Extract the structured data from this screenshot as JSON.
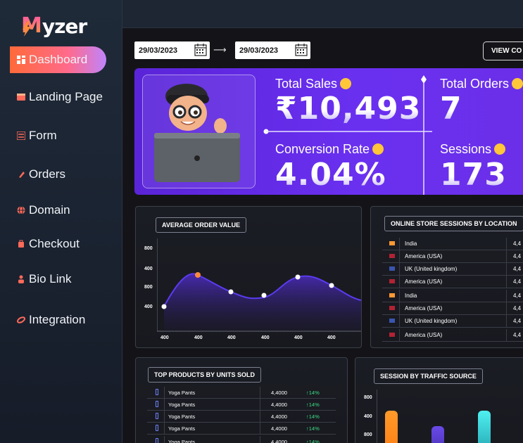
{
  "brand": {
    "logo_initial": "M",
    "logo_rest": "yzer"
  },
  "sidebar": {
    "items": [
      {
        "label": "Dashboard",
        "icon": "grid-icon",
        "active": true
      },
      {
        "label": "Landing Page",
        "icon": "landing-page-icon"
      },
      {
        "label": "Form",
        "icon": "form-icon"
      },
      {
        "label": "Orders",
        "icon": "orders-icon"
      },
      {
        "label": "Domain",
        "icon": "globe-icon"
      },
      {
        "label": "Checkout",
        "icon": "checkout-icon"
      },
      {
        "label": "Bio Link",
        "icon": "user-icon"
      },
      {
        "label": "Integration",
        "icon": "link-icon"
      }
    ]
  },
  "filters": {
    "start_date": "29/03/2023",
    "end_date": "29/03/2023",
    "arrow": "⟶",
    "view_button": "VIEW CO"
  },
  "stats": {
    "total_sales": {
      "label": "Total Sales",
      "value": "₹10,493"
    },
    "total_orders": {
      "label": "Total Orders",
      "value": "7"
    },
    "conversion_rate": {
      "label": "Conversion Rate",
      "value": "4.04%"
    },
    "sessions": {
      "label": "Sessions",
      "value": "173"
    }
  },
  "average_order_value": {
    "title": "AVERAGE ORDER VALUE",
    "y_ticks": [
      "800",
      "400",
      "800",
      "400"
    ],
    "x_ticks": [
      "400",
      "400",
      "400",
      "400",
      "400",
      "400"
    ]
  },
  "sessions_by_location": {
    "title": "ONLINE STORE SESSIONS BY LOCATION",
    "rows": [
      {
        "country": "India",
        "value": "4,4",
        "flag_color": "#ff9933"
      },
      {
        "country": "America (USA)",
        "value": "4,4",
        "flag_color": "#b22234"
      },
      {
        "country": "UK (United kingdom)",
        "value": "4,4",
        "flag_color": "#3a55b0"
      },
      {
        "country": "America (USA)",
        "value": "4,4",
        "flag_color": "#b22234"
      },
      {
        "country": "India",
        "value": "4,4",
        "flag_color": "#ff9933"
      },
      {
        "country": "America (USA)",
        "value": "4,4",
        "flag_color": "#b22234"
      },
      {
        "country": "UK (United kingdom)",
        "value": "4,4",
        "flag_color": "#3a55b0"
      },
      {
        "country": "America (USA)",
        "value": "4,4",
        "flag_color": "#b22234"
      }
    ]
  },
  "top_products": {
    "title": "TOP PRODUCTS BY UNITS SOLD",
    "rows": [
      {
        "name": "Yoga Pants",
        "units": "4,4000",
        "change": "↑14%"
      },
      {
        "name": "Yoga Pants",
        "units": "4,4000",
        "change": "↑14%"
      },
      {
        "name": "Yoga Pants",
        "units": "4,4000",
        "change": "↑14%"
      },
      {
        "name": "Yoga Pants",
        "units": "4,4000",
        "change": "↑14%"
      },
      {
        "name": "Yoga Pants",
        "units": "4,4000",
        "change": "↑14%"
      }
    ]
  },
  "traffic_source": {
    "title": "SESSION BY TRAFFIC SOURCE",
    "y_ticks": [
      "800",
      "400",
      "800"
    ],
    "bar_colors": [
      "#ff8a1a",
      "#5a3fd6",
      "#3fe0e0"
    ]
  },
  "colors": {
    "accent_gradient_start": "#ff6a3a",
    "accent_gradient_end": "#c084fc",
    "hero_purple": "#6a30f0",
    "positive": "#3ddc84"
  }
}
